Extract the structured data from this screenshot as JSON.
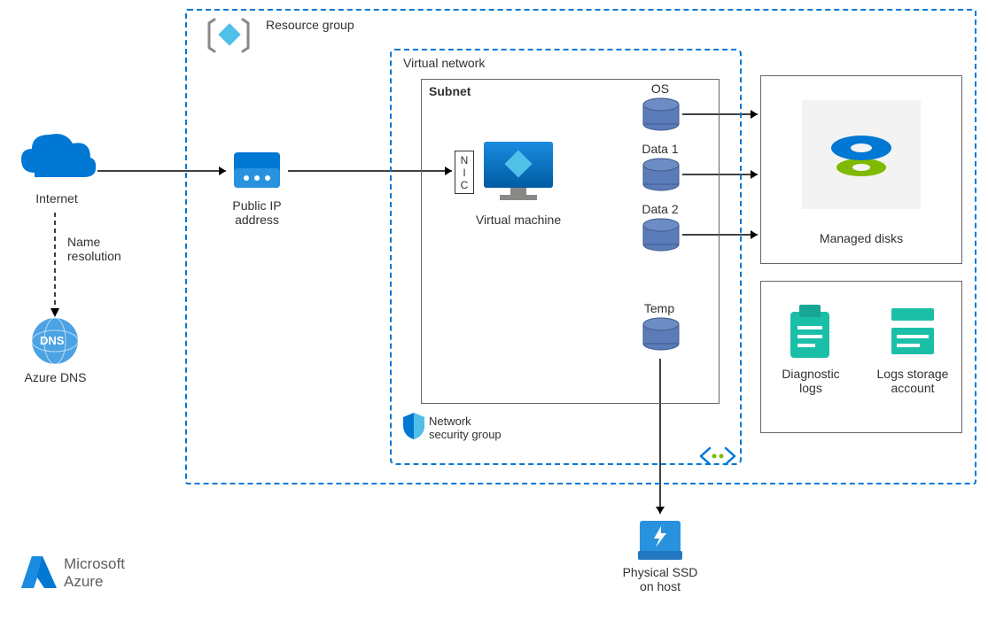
{
  "internet": {
    "label": "Internet"
  },
  "name_resolution": {
    "label": "Name\nresolution"
  },
  "azure_dns": {
    "label": "Azure DNS",
    "badge": "DNS"
  },
  "resource_group": {
    "label": "Resource group"
  },
  "public_ip": {
    "label": "Public IP\naddress"
  },
  "virtual_network": {
    "label": "Virtual network"
  },
  "subnet": {
    "label": "Subnet"
  },
  "nic": {
    "label_chars": [
      "N",
      "I",
      "C"
    ]
  },
  "virtual_machine": {
    "label": "Virtual machine"
  },
  "disks": {
    "os": "OS",
    "data1": "Data 1",
    "data2": "Data 2",
    "temp": "Temp"
  },
  "nsg": {
    "label": "Network\nsecurity group"
  },
  "managed_disks": {
    "label": "Managed disks"
  },
  "diagnostic_logs": {
    "label": "Diagnostic\nlogs"
  },
  "logs_storage": {
    "label": "Logs storage\naccount"
  },
  "physical_ssd": {
    "label": "Physical SSD\non host"
  },
  "azure_logo": {
    "label": "Microsoft\nAzure"
  }
}
